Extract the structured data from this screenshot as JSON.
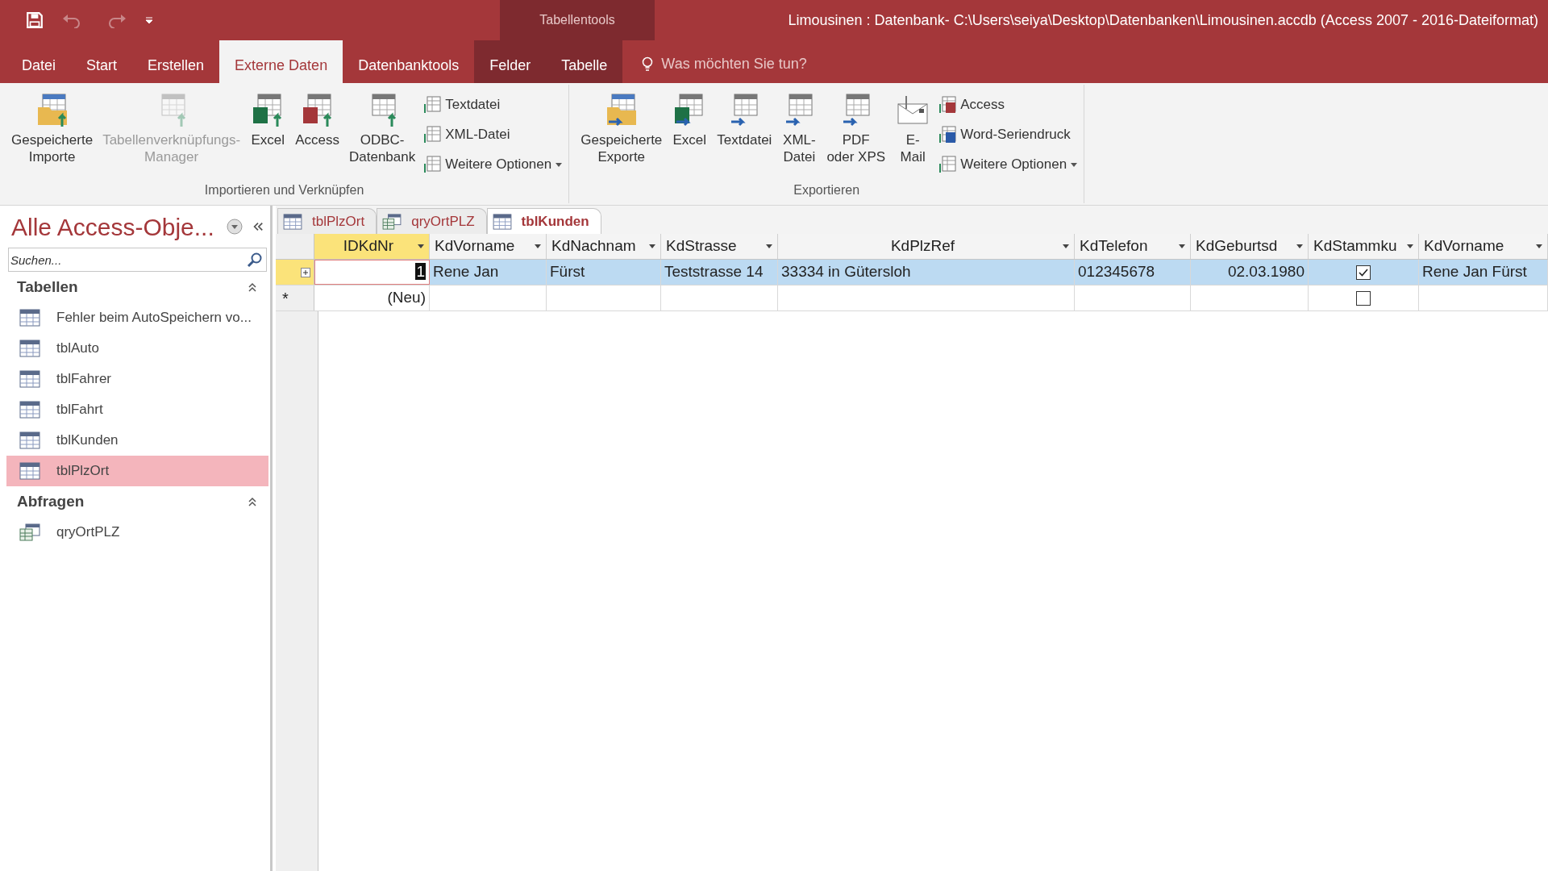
{
  "window": {
    "title": "Limousinen : Datenbank- C:\\Users\\seiya\\Desktop\\Datenbanken\\Limousinen.accdb (Access 2007 - 2016-Dateiformat)",
    "contextual_group": "Tabellentools"
  },
  "ribbon_tabs": [
    {
      "label": "Datei",
      "selected": false,
      "kind": "standard"
    },
    {
      "label": "Start",
      "selected": false,
      "kind": "standard"
    },
    {
      "label": "Erstellen",
      "selected": false,
      "kind": "standard"
    },
    {
      "label": "Externe Daten",
      "selected": true,
      "kind": "standard"
    },
    {
      "label": "Datenbanktools",
      "selected": false,
      "kind": "standard"
    },
    {
      "label": "Felder",
      "selected": false,
      "kind": "contextual"
    },
    {
      "label": "Tabelle",
      "selected": false,
      "kind": "contextual"
    }
  ],
  "tell_me": {
    "placeholder": "Was möchten Sie tun?"
  },
  "ribbon_groups": [
    {
      "label": "Importieren und Verknüpfen",
      "buttons": [
        {
          "label": "Gespeicherte\nImporte",
          "kind": "large",
          "disabled": false
        },
        {
          "label": "Tabellenverknüpfungs-\nManager",
          "kind": "large",
          "disabled": true
        },
        {
          "label": "Excel",
          "kind": "large",
          "disabled": false
        },
        {
          "label": "Access",
          "kind": "large",
          "disabled": false
        },
        {
          "label": "ODBC-\nDatenbank",
          "kind": "large",
          "disabled": false
        },
        {
          "label": "Textdatei",
          "kind": "small",
          "disabled": false
        },
        {
          "label": "XML-Datei",
          "kind": "small",
          "disabled": false
        },
        {
          "label": "Weitere Optionen",
          "kind": "small",
          "disabled": false
        }
      ]
    },
    {
      "label": "Exportieren",
      "buttons": [
        {
          "label": "Gespeicherte\nExporte",
          "kind": "large",
          "disabled": false
        },
        {
          "label": "Excel",
          "kind": "large",
          "disabled": false
        },
        {
          "label": "Textdatei",
          "kind": "large",
          "disabled": false
        },
        {
          "label": "XML-\nDatei",
          "kind": "large",
          "disabled": false
        },
        {
          "label": "PDF\noder XPS",
          "kind": "large",
          "disabled": false
        },
        {
          "label": "E-\nMail",
          "kind": "large",
          "disabled": false
        },
        {
          "label": "Access",
          "kind": "small",
          "disabled": false
        },
        {
          "label": "Word-Seriendruck",
          "kind": "small",
          "disabled": false
        },
        {
          "label": "Weitere Optionen",
          "kind": "small",
          "disabled": false
        }
      ]
    }
  ],
  "navigation": {
    "title": "Alle Access-Obje...",
    "search": {
      "placeholder": "Suchen..."
    },
    "groups": [
      {
        "label": "Tabellen",
        "expanded": true,
        "items": [
          {
            "label": "Fehler beim AutoSpeichern vo...",
            "kind": "table",
            "selected": false
          },
          {
            "label": "tblAuto",
            "kind": "table",
            "selected": false
          },
          {
            "label": "tblFahrer",
            "kind": "table",
            "selected": false
          },
          {
            "label": "tblFahrt",
            "kind": "table",
            "selected": false
          },
          {
            "label": "tblKunden",
            "kind": "table",
            "selected": false
          },
          {
            "label": "tblPlzOrt",
            "kind": "table",
            "selected": true
          }
        ]
      },
      {
        "label": "Abfragen",
        "expanded": true,
        "items": [
          {
            "label": "qryOrtPLZ",
            "kind": "query",
            "selected": false
          }
        ]
      }
    ]
  },
  "document_tabs": [
    {
      "label": "tblPlzOrt",
      "kind": "table",
      "selected": false
    },
    {
      "label": "qryOrtPLZ",
      "kind": "query",
      "selected": false
    },
    {
      "label": "tblKunden",
      "kind": "table",
      "selected": true
    }
  ],
  "datasheet": {
    "columns": [
      {
        "label": "IDKdNr",
        "selected": true
      },
      {
        "label": "KdVorname",
        "selected": false
      },
      {
        "label": "KdNachnam",
        "selected": false
      },
      {
        "label": "KdStrasse",
        "selected": false
      },
      {
        "label": "KdPlzRef",
        "selected": false
      },
      {
        "label": "KdTelefon",
        "selected": false
      },
      {
        "label": "KdGeburtsd",
        "selected": false
      },
      {
        "label": "KdStammku",
        "selected": false
      },
      {
        "label": "KdVorname",
        "selected": false
      }
    ],
    "rows": [
      {
        "kind": "record",
        "selected": true,
        "cells": [
          {
            "kind": "number",
            "value": "1",
            "focused": true
          },
          {
            "kind": "text",
            "value": "Rene Jan"
          },
          {
            "kind": "text",
            "value": "Fürst"
          },
          {
            "kind": "text",
            "value": "Teststrasse 14"
          },
          {
            "kind": "text",
            "value": "33334 in Gütersloh"
          },
          {
            "kind": "text",
            "value": "012345678"
          },
          {
            "kind": "number",
            "value": "02.03.1980"
          },
          {
            "kind": "check",
            "checked": true
          },
          {
            "kind": "text",
            "value": "Rene Jan Fürst"
          }
        ]
      },
      {
        "kind": "new",
        "marker": "*",
        "selected": false,
        "cells": [
          {
            "kind": "number",
            "value": "(Neu)",
            "focused": false
          },
          {
            "kind": "empty"
          },
          {
            "kind": "empty"
          },
          {
            "kind": "empty"
          },
          {
            "kind": "empty"
          },
          {
            "kind": "empty"
          },
          {
            "kind": "empty"
          },
          {
            "kind": "check",
            "checked": false
          },
          {
            "kind": "empty"
          }
        ]
      }
    ]
  }
}
